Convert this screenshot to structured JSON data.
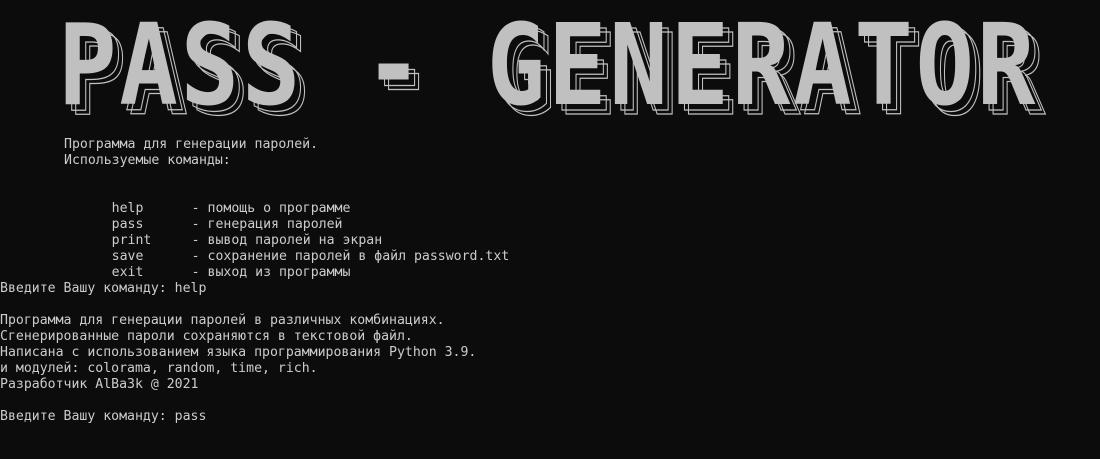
{
  "banner": {
    "title": "PASS - GENERATOR",
    "fill_color": "#c0c0c0",
    "outline_color": "#c0c0c0"
  },
  "intro": {
    "line1": "Программа для генерации паролей.",
    "line2": "Используемые команды:"
  },
  "commands": [
    {
      "name": "help",
      "desc": "- помощь о программе"
    },
    {
      "name": "pass",
      "desc": "- генерация паролей"
    },
    {
      "name": "print",
      "desc": "- вывод паролей на экран"
    },
    {
      "name": "save",
      "desc": "- сохранение паролей в файл password.txt"
    },
    {
      "name": "exit",
      "desc": "- выход из программы"
    }
  ],
  "prompt1": "Введите Вашу команду: help",
  "help_output": [
    "Программа для генерации паролей в различных комбинациях.",
    "Сгенерированные пароли сохраняются в текстовой файл.",
    "Написана с использованием языка программирования Python 3.9.",
    "и модулей: colorama, random, time, rich.",
    "Разработчик AlBa3k @ 2021"
  ],
  "prompt2": "Введите Вашу команду: pass",
  "colors": {
    "background": "#0c0c0c",
    "text": "#cccccc"
  }
}
